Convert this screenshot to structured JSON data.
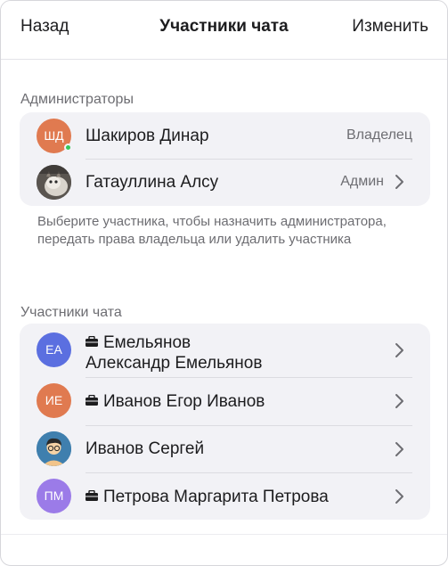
{
  "header": {
    "back_label": "Назад",
    "title": "Участники чата",
    "edit_label": "Изменить"
  },
  "admins": {
    "section_label": "Администраторы",
    "items": [
      {
        "initials": "ШД",
        "name": "Шакиров Динар",
        "role": "Владелец",
        "online": true,
        "avatar_color": "#e07a50"
      },
      {
        "initials": "",
        "name": "Гатауллина Алсу",
        "role": "Админ",
        "photo": "cat-photo"
      }
    ]
  },
  "hint": "Выберите участника, чтобы назначить администратора, передать права владельца или удалить участника",
  "members": {
    "section_label": "Участники чата",
    "items": [
      {
        "initials": "ЕА",
        "name_line1": "Емельянов",
        "name_line2": "Александр Емельянов",
        "badge_icon": "briefcase-icon",
        "avatar_color": "#5b6fe0"
      },
      {
        "initials": "ИЕ",
        "name": "Иванов Егор Иванов",
        "badge_icon": "briefcase-icon",
        "avatar_color": "#e07a50"
      },
      {
        "initials": "",
        "name": "Иванов Сергей",
        "photo": "illustrated-avatar"
      },
      {
        "initials": "ПМ",
        "name": "Петрова Маргарита Петрова",
        "badge_icon": "briefcase-icon",
        "avatar_color": "#9b7be8"
      }
    ]
  },
  "colors": {
    "card_bg": "#f2f2f6",
    "online": "#34c759",
    "secondary_text": "#6d6d72"
  }
}
